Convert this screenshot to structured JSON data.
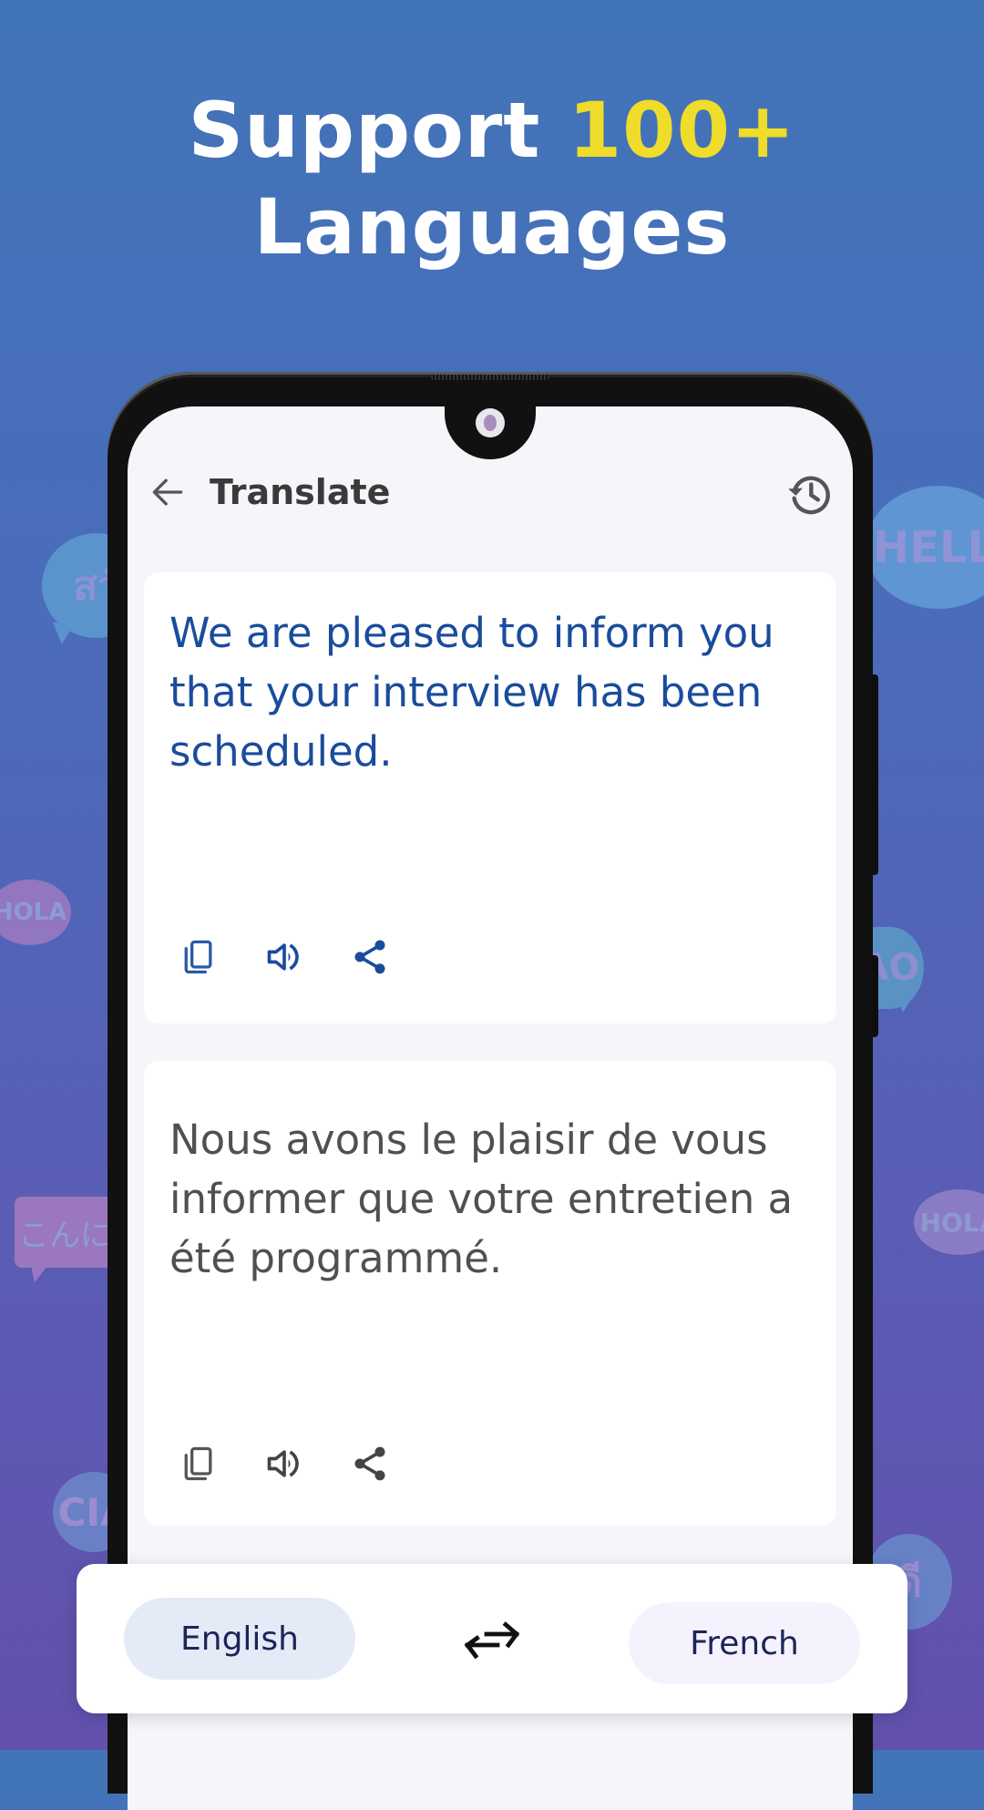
{
  "headline": {
    "line1_prefix": "Support",
    "line1_accent": "100+",
    "line2": "Languages",
    "accent_color": "#efdc2b"
  },
  "background_bubbles": [
    {
      "text": "สวั",
      "language": "thai"
    },
    {
      "text": "HELLO",
      "language": "english"
    },
    {
      "text": "HOLA",
      "language": "spanish"
    },
    {
      "text": "AO",
      "language": "italian"
    },
    {
      "text": "こんに",
      "language": "japanese"
    },
    {
      "text": "HOLA",
      "language": "spanish"
    },
    {
      "text": "CIA",
      "language": "italian"
    },
    {
      "text": "ดี",
      "language": "thai"
    }
  ],
  "appbar": {
    "back_icon": "arrow-left-icon",
    "title": "Translate",
    "history_icon": "history-icon"
  },
  "source_card": {
    "text": "We are pleased to inform you that your interview has been scheduled.",
    "text_color": "#1a4c9c",
    "actions": [
      {
        "icon": "copy-icon",
        "label": "Copy"
      },
      {
        "icon": "speaker-icon",
        "label": "Speak"
      },
      {
        "icon": "share-icon",
        "label": "Share"
      }
    ]
  },
  "target_card": {
    "text": "Nous avons le plaisir de vous informer que votre entretien a été programmé.",
    "text_color": "#505050",
    "actions": [
      {
        "icon": "copy-icon",
        "label": "Copy"
      },
      {
        "icon": "speaker-icon",
        "label": "Speak"
      },
      {
        "icon": "share-icon",
        "label": "Share"
      }
    ]
  },
  "language_bar": {
    "source_language": "English",
    "target_language": "French",
    "swap_icon": "swap-arrows-icon"
  }
}
